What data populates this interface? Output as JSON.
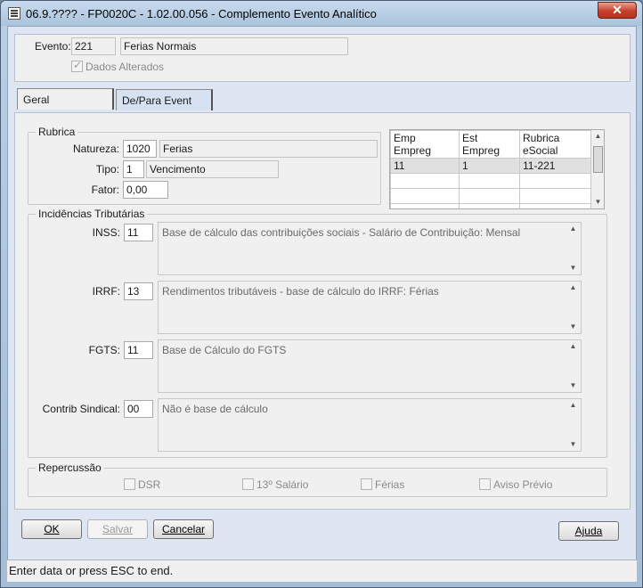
{
  "window": {
    "title": "06.9.???? - FP0020C - 1.02.00.056 - Complemento Evento Analítico",
    "close_glyph": "✕"
  },
  "header": {
    "evento_label": "Evento:",
    "evento_code": "221",
    "evento_desc": "Ferias Normais",
    "dados_alterados_label": "Dados Alterados",
    "dados_alterados_checked": true
  },
  "tabs": [
    {
      "label": "Geral",
      "active": true
    },
    {
      "label": "De/Para Event",
      "active": false
    }
  ],
  "rubrica": {
    "title": "Rubrica",
    "natureza_label": "Natureza:",
    "natureza_value": "1020",
    "natureza_desc": "Ferias",
    "tipo_label": "Tipo:",
    "tipo_value": "1",
    "tipo_desc": "Vencimento",
    "fator_label": "Fator:",
    "fator_value": "0,00"
  },
  "grid": {
    "columns": [
      "Emp Empreg",
      "Est Empreg",
      "Rubrica eSocial"
    ],
    "rows": [
      [
        "11",
        "1",
        "11-221"
      ],
      [
        "",
        "",
        ""
      ],
      [
        "",
        "",
        ""
      ],
      [
        "",
        "",
        ""
      ]
    ]
  },
  "incidencias": {
    "title": "Incidências Tributárias",
    "inss_label": "INSS:",
    "inss_value": "11",
    "inss_desc": "Base de cálculo das contribuições sociais - Salário de Contribuição: Mensal",
    "irrf_label": "IRRF:",
    "irrf_value": "13",
    "irrf_desc": "Rendimentos tributáveis - base de cálculo do IRRF: Férias",
    "fgts_label": "FGTS:",
    "fgts_value": "11",
    "fgts_desc": "Base de Cálculo do FGTS",
    "sindical_label": "Contrib Sindical:",
    "sindical_value": "00",
    "sindical_desc": "Não é base de cálculo"
  },
  "repercussao": {
    "title": "Repercussão",
    "options": [
      "DSR",
      "13º Salário",
      "Férias",
      "Aviso Prévio"
    ]
  },
  "buttons": {
    "ok": "OK",
    "salvar": "Salvar",
    "cancelar": "Cancelar",
    "ajuda": "Ajuda"
  },
  "status": {
    "text": "Enter data or press ESC to end."
  }
}
